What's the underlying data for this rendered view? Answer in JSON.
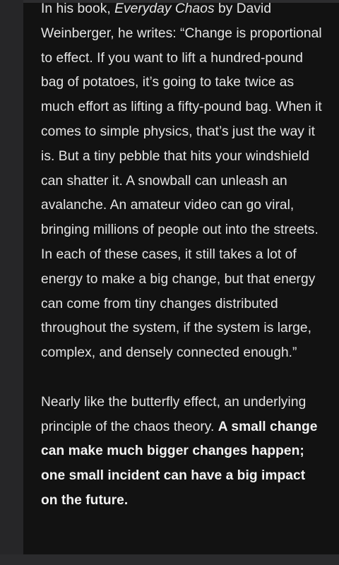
{
  "article": {
    "paragraph_1": {
      "intro": "In his book, ",
      "book_title": "Everyday Chaos",
      "author_and_quote": " by David Weinberger, he writes: “Change is proportional to effect. If you want to lift a hundred-pound bag of potatoes, it’s going to take twice as much effort as lifting a fifty-pound bag. When it comes to simple physics, that’s just the way it is. But a tiny pebble that hits your windshield can shatter it. A snowball can unleash an avalanche. An amateur video can go viral, bringing millions of people out into the streets. In each of these cases, it still takes a lot of energy to make a big change, but that energy can come from tiny changes distributed throughout the system, if the system is large, complex, and densely connected enough.”"
    },
    "paragraph_2": {
      "text": "Nearly like the butterfly effect, an underlying principle of the chaos theory. ",
      "emphasis": "A small change can make much bigger changes happen; one small incident can have a big impact on the future."
    }
  }
}
